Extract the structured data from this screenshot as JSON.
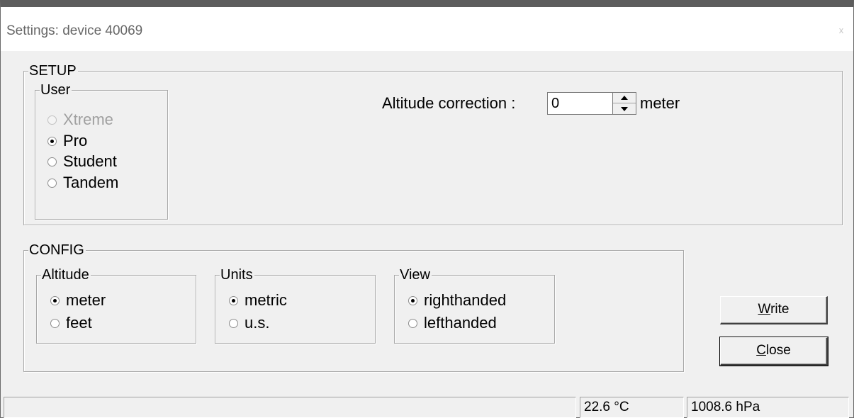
{
  "window": {
    "title": "Settings: device 40069",
    "close_glyph": "x"
  },
  "setup": {
    "legend": "SETUP",
    "user_group": {
      "legend": "User",
      "options": [
        {
          "label": "Xtreme",
          "checked": false,
          "disabled": true
        },
        {
          "label": "Pro",
          "checked": true,
          "disabled": false
        },
        {
          "label": "Student",
          "checked": false,
          "disabled": false
        },
        {
          "label": "Tandem",
          "checked": false,
          "disabled": false
        }
      ]
    },
    "altitude_correction": {
      "label": "Altitude correction :",
      "value": "0",
      "unit": "meter"
    }
  },
  "config": {
    "legend": "CONFIG",
    "altitude_group": {
      "legend": "Altitude",
      "options": [
        {
          "label": "meter",
          "checked": true
        },
        {
          "label": "feet",
          "checked": false
        }
      ]
    },
    "units_group": {
      "legend": "Units",
      "options": [
        {
          "label": "metric",
          "checked": true
        },
        {
          "label": "u.s.",
          "checked": false
        }
      ]
    },
    "view_group": {
      "legend": "View",
      "options": [
        {
          "label": "righthanded",
          "checked": true
        },
        {
          "label": "lefthanded",
          "checked": false
        }
      ]
    }
  },
  "buttons": {
    "write": {
      "mnemonic": "W",
      "rest": "rite"
    },
    "close": {
      "mnemonic": "C",
      "rest": "lose"
    }
  },
  "statusbar": {
    "temperature": "22.6 °C",
    "pressure": "1008.6 hPa"
  }
}
